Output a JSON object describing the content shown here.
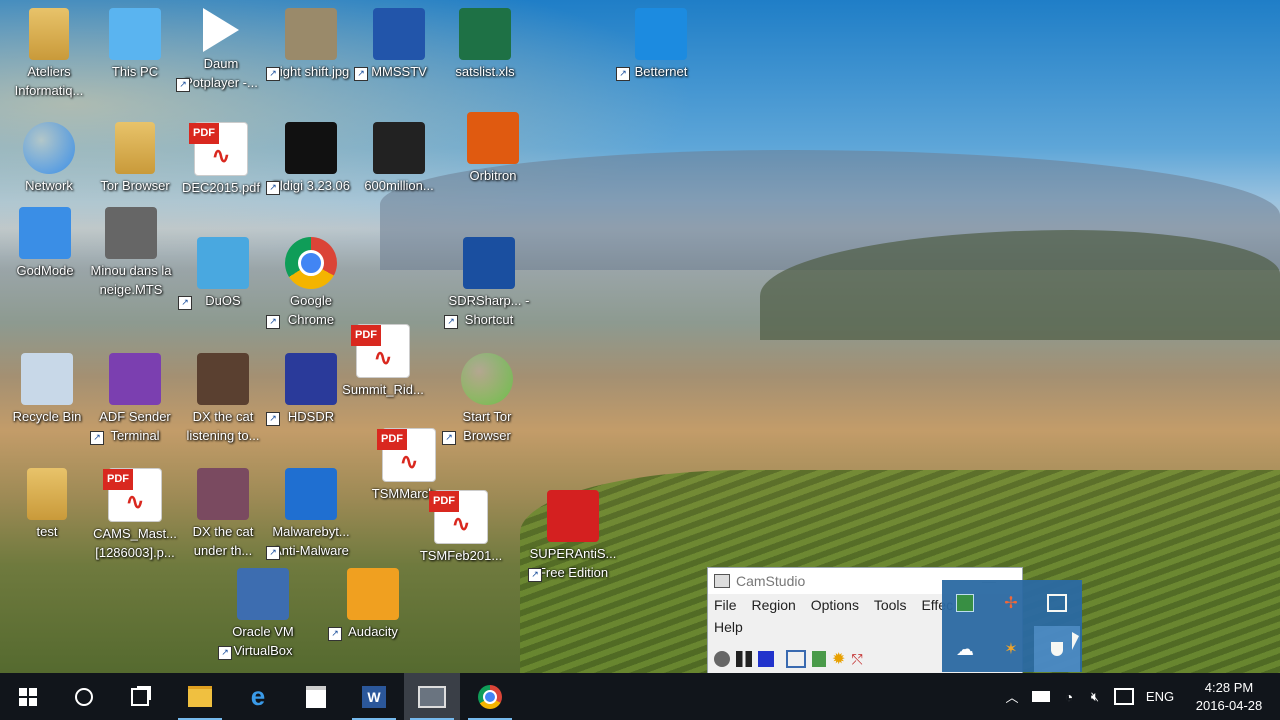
{
  "desktop": {
    "icons": [
      {
        "label": "Ateliers Informatiq...",
        "icon": "folder-user-icon",
        "color": "#e8c36a",
        "shortcut": false
      },
      {
        "label": "This PC",
        "icon": "monitor-icon",
        "color": "#5ab4f0",
        "shortcut": false
      },
      {
        "label": "Daum Potplayer -...",
        "icon": "play-icon",
        "color": "#ffffff",
        "shortcut": true
      },
      {
        "label": "night shift.jpg",
        "icon": "image-icon",
        "color": "#9a8a6a",
        "shortcut": true
      },
      {
        "label": "MMSSTV",
        "icon": "sstv-icon",
        "color": "#2255aa",
        "shortcut": true
      },
      {
        "label": "satslist.xls",
        "icon": "excel-icon",
        "color": "#1e7145",
        "shortcut": false
      },
      {
        "label": "Betternet",
        "icon": "betternet-icon",
        "color": "#1c8be0",
        "shortcut": true
      },
      {
        "label": "Network",
        "icon": "globe-icon",
        "color": "#3a8ee6",
        "shortcut": false
      },
      {
        "label": "Tor Browser",
        "icon": "tor-folder-icon",
        "color": "#e8c36a",
        "shortcut": false
      },
      {
        "label": "DEC2015.pdf",
        "icon": "pdf-icon",
        "color": "#d9281f",
        "shortcut": false
      },
      {
        "label": "Fldigi 3.23.06",
        "icon": "fldigi-icon",
        "color": "#111111",
        "shortcut": true
      },
      {
        "label": "600million...",
        "icon": "video-icon",
        "color": "#222222",
        "shortcut": false
      },
      {
        "label": "Orbitron",
        "icon": "orbitron-icon",
        "color": "#e05a10",
        "shortcut": false
      },
      {
        "label": "GodMode",
        "icon": "control-panel-icon",
        "color": "#3a8ee6",
        "shortcut": false
      },
      {
        "label": "Minou dans la neige.MTS",
        "icon": "video-icon",
        "color": "#666666",
        "shortcut": false
      },
      {
        "label": "DuOS",
        "icon": "duos-icon",
        "color": "#49a8e0",
        "shortcut": true
      },
      {
        "label": "Google Chrome",
        "icon": "chrome-icon",
        "color": "#db4437",
        "shortcut": true
      },
      {
        "label": "SDRSharp... - Shortcut",
        "icon": "sdrsharp-icon",
        "color": "#1a4fa0",
        "shortcut": true
      },
      {
        "label": "Summit_Rid...",
        "icon": "pdf-icon",
        "color": "#d9281f",
        "shortcut": false
      },
      {
        "label": "Recycle Bin",
        "icon": "recycle-bin-icon",
        "color": "#c8d8e8",
        "shortcut": false
      },
      {
        "label": "ADF Sender Terminal",
        "icon": "adf-icon",
        "color": "#7b3fb0",
        "shortcut": true
      },
      {
        "label": "DX the cat listening to...",
        "icon": "video-icon",
        "color": "#5a4030",
        "shortcut": false
      },
      {
        "label": "HDSDR",
        "icon": "hdsdr-icon",
        "color": "#2a3a9a",
        "shortcut": true
      },
      {
        "label": "Start Tor Browser",
        "icon": "tor-globe-icon",
        "color": "#6abf4b",
        "shortcut": true
      },
      {
        "label": "TSMMarch...",
        "icon": "pdf-icon",
        "color": "#d9281f",
        "shortcut": false
      },
      {
        "label": "test",
        "icon": "folder-icon",
        "color": "#e8c36a",
        "shortcut": false
      },
      {
        "label": "CAMS_Mast... [1286003].p...",
        "icon": "pdf-icon",
        "color": "#d9281f",
        "shortcut": false
      },
      {
        "label": "DX the cat under th...",
        "icon": "video-icon",
        "color": "#7a4a60",
        "shortcut": false
      },
      {
        "label": "Malwarebyt... Anti-Malware",
        "icon": "malwarebytes-icon",
        "color": "#1f6fd1",
        "shortcut": true
      },
      {
        "label": "TSMFeb201...",
        "icon": "pdf-icon",
        "color": "#d9281f",
        "shortcut": false
      },
      {
        "label": "SUPERAntiS... Free Edition",
        "icon": "superantispyware-icon",
        "color": "#d42020",
        "shortcut": true
      },
      {
        "label": "Oracle VM VirtualBox",
        "icon": "virtualbox-icon",
        "color": "#3d6db0",
        "shortcut": true
      },
      {
        "label": "Audacity",
        "icon": "audacity-icon",
        "color": "#f0a020",
        "shortcut": true
      }
    ],
    "pdf_badge": "PDF"
  },
  "camstudio": {
    "title": "CamStudio",
    "menu": [
      "File",
      "Region",
      "Options",
      "Tools",
      "Effec",
      "Help"
    ]
  },
  "tray": {
    "language": "ENG",
    "time": "4:28 PM",
    "date": "2016-04-28"
  }
}
